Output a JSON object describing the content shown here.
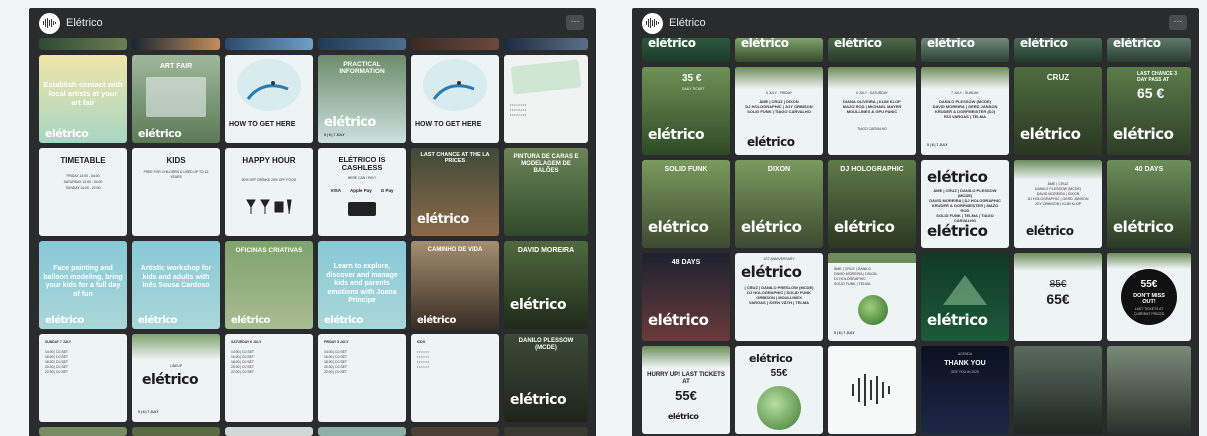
{
  "windows": [
    {
      "title": "Elétrico",
      "more_label": "···"
    },
    {
      "title": "Elétrico",
      "more_label": "···"
    }
  ],
  "left_tiles": {
    "info_establish": "Establish contact with local artists at your art fair",
    "art_fair": "ART FAIR",
    "how_to_get_here": "HOW TO GET HERE",
    "practical_information": "PRACTICAL INFORMATION",
    "timetable": "TIMETABLE",
    "timetable_lines": [
      "FRIDAY 14:00 - 04:00",
      "SATURDAY 14:00 - 04:00",
      "SUNDAY 14:00 - 22:00"
    ],
    "kids": "KIDS",
    "kids_sub": "FREE FOR CHILDREN & USED UP TO 12 YEARS",
    "happy_hour": "HAPPY HOUR",
    "happy_hour_sub": "50% OFF DRINKS 20% OFF FOOD",
    "cashless": "ELÉTRICO IS CASHLESS",
    "cashless_sub": "HERE CAN I PAY?",
    "pay_methods": [
      "VISA",
      "Apple Pay",
      "G Pay"
    ],
    "last_chance": "LAST CHANCE AT THE LA PRICES",
    "pintura": "PINTURA DE CARAS E MODELAGEM DE BALÕES",
    "face_painting": "Face painting and balloon modeling, bring your kids for a full day of fun",
    "artistic_workshop": "Artistic workshop for kids and adults with Inês Sousa Cardoso",
    "oficinas": "OFICINAS CRIATIVAS",
    "learn_explore": "Learn to explore, discover and manage kids and parents emotions with Joana Príncipe",
    "caminho": "CAMINHO DE VIDA",
    "davido": "DAVID MOREIRA",
    "lineup": "LINEUP",
    "danilo": "DANILO PLESSOW (MCDE)",
    "days_sat": "SATURDAY 6 JULY",
    "days_fri": "FRIDAY 5 JULY",
    "days_sun": "SUNDAY 7 JULY",
    "date_line": "5 | 6 | 7 JULY",
    "brand": "elétrico",
    "price_35": "35 €"
  },
  "right_tiles": {
    "days_5july": "5 JULY - FRIDAY",
    "days_6july": "6 JULY - SATURDAY",
    "days_7july": "7 JULY - SUNDAY",
    "lineup_fri": [
      "ÂME",
      "CRUZ",
      "DIXON",
      "DJ HOLOGRAPHIC",
      "JOY ORBISON",
      "SOLID FUNK",
      "TIAGO CARVALHO"
    ],
    "lineup_sat": [
      "DIANA OLIVEIRA",
      "KLIM KLOP",
      "MAZO ROD",
      "MICHAEL MAYER",
      "MOULLINEX & GPU PANIC",
      "TIAGO CARVALHO"
    ],
    "lineup_sun": [
      "DANILO PLESSOW (MCDE)",
      "DAVID MOREIRA",
      "GERD JANSON",
      "KRUDER & DORFMEISTER (DJ)",
      "RUI VARGAS",
      "TELMA"
    ],
    "cruz": "CRUZ",
    "last_chance": "LAST CHANCE 3 DAY PASS AT",
    "price_65": "65 €",
    "solid_funk": "SOLID FUNK",
    "dixon": "DIXON",
    "dj_holographic": "DJ HOLOGRAPHIC",
    "forty_days": "40 DAYS",
    "forty_eight_days": "48 DAYS",
    "anniversary": "1ST ANNIVERSARY",
    "price_old": "85€",
    "price_new": "65€",
    "price_55": "55€",
    "dont_miss": "DON'T MISS OUT!",
    "dont_miss_sub": "LAST TICKETS AT CURRENT PRICES",
    "hurry_up": "HURRY UP! LAST TICKETS AT",
    "hurry_price": "55€",
    "thank_you": "THANK YOU",
    "thank_sub": "SEE YOU IN 2025",
    "agenda": "AGENDA",
    "date_line": "5 | 6 | 7 JULY",
    "brand": "elétrico",
    "price_35": "35 €",
    "daily_ticket": "DAILY TICKET"
  }
}
